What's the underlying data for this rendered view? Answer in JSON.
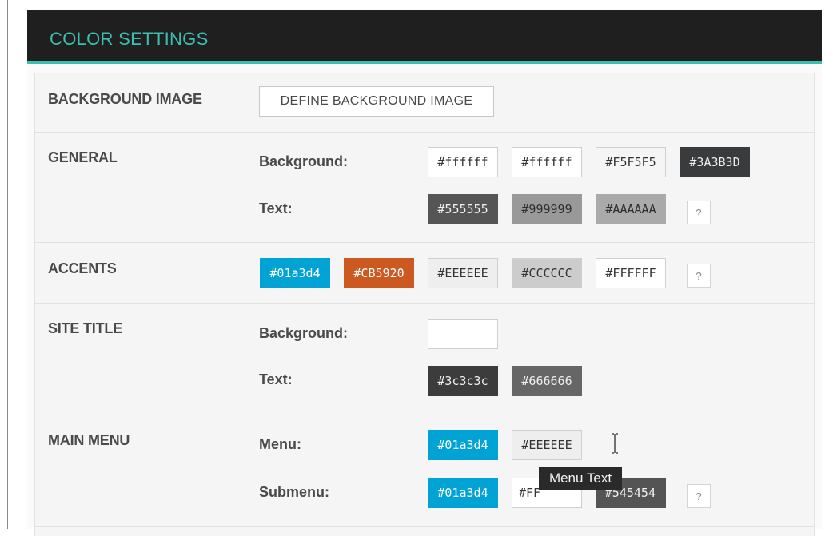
{
  "header": {
    "title": "COLOR SETTINGS",
    "accent": "#3bbfb0",
    "background": "#1f1f1f"
  },
  "sections": {
    "background_image": {
      "label": "BACKGROUND IMAGE",
      "button": "DEFINE BACKGROUND IMAGE"
    },
    "general": {
      "label": "GENERAL",
      "background_label": "Background:",
      "background_swatches": [
        "#ffffff",
        "#ffffff",
        "#F5F5F5",
        "#3A3B3D"
      ],
      "text_label": "Text:",
      "text_swatches": [
        "#555555",
        "#999999",
        "#AAAAAA"
      ],
      "help": "?"
    },
    "accents": {
      "label": "ACCENTS",
      "swatches": [
        "#01a3d4",
        "#CB5920",
        "#EEEEEE",
        "#CCCCCC",
        "#FFFFFF"
      ],
      "help": "?"
    },
    "site_title": {
      "label": "SITE TITLE",
      "background_label": "Background:",
      "background_swatches": [
        ""
      ],
      "text_label": "Text:",
      "text_swatches": [
        "#3c3c3c",
        "#666666"
      ]
    },
    "main_menu": {
      "label": "MAIN MENU",
      "menu_label": "Menu:",
      "menu_swatches": [
        "#01a3d4",
        "#EEEEEE"
      ],
      "submenu_label": "Submenu:",
      "submenu_swatches": [
        "#01a3d4",
        "#FF",
        "#545454"
      ],
      "help": "?"
    }
  },
  "tooltip": {
    "text": "Menu Text"
  }
}
